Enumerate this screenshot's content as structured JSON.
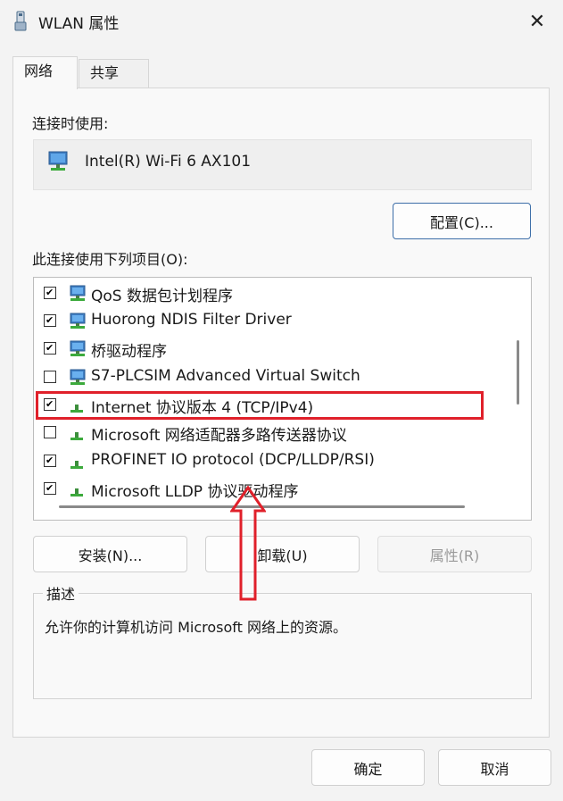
{
  "window": {
    "title": "WLAN 属性"
  },
  "tabs": [
    {
      "label": "网络"
    },
    {
      "label": "共享"
    }
  ],
  "connect_using_label": "连接时使用:",
  "adapter": {
    "name": "Intel(R) Wi-Fi 6 AX101"
  },
  "configure_button": "配置(C)...",
  "items_label": "此连接使用下列项目(O):",
  "items": [
    {
      "label": "QoS 数据包计划程序",
      "checked": true,
      "icon": "network-icon"
    },
    {
      "label": "Huorong NDIS Filter Driver",
      "checked": true,
      "icon": "network-icon"
    },
    {
      "label": "桥驱动程序",
      "checked": true,
      "icon": "network-icon"
    },
    {
      "label": "S7-PLCSIM Advanced Virtual Switch",
      "checked": false,
      "icon": "network-icon"
    },
    {
      "label": "Internet 协议版本 4 (TCP/IPv4)",
      "checked": true,
      "icon": "protocol-icon"
    },
    {
      "label": "Microsoft 网络适配器多路传送器协议",
      "checked": false,
      "icon": "protocol-icon"
    },
    {
      "label": "PROFINET IO protocol (DCP/LLDP/RSI)",
      "checked": true,
      "icon": "protocol-icon"
    },
    {
      "label": "Microsoft LLDP 协议驱动程序",
      "checked": true,
      "icon": "protocol-icon"
    }
  ],
  "buttons": {
    "install": "安装(N)...",
    "uninstall": "卸载(U)",
    "properties": "属性(R)"
  },
  "description": {
    "legend": "描述",
    "text": "允许你的计算机访问 Microsoft 网络上的资源。"
  },
  "footer": {
    "ok": "确定",
    "cancel": "取消"
  },
  "colors": {
    "annotation": "#e0202a",
    "accent_border": "#3d6ea8"
  }
}
